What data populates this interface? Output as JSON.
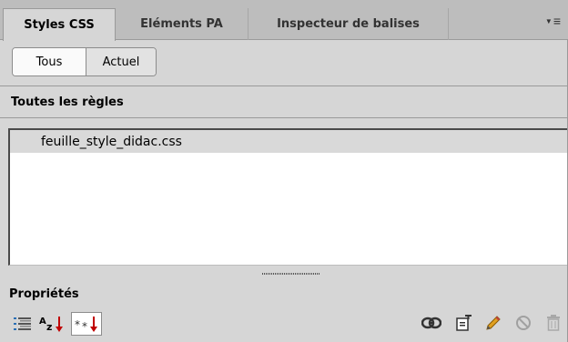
{
  "tabs": [
    {
      "label": "Styles CSS",
      "active": true
    },
    {
      "label": "Eléments PA",
      "active": false
    },
    {
      "label": "Inspecteur de balises",
      "active": false
    }
  ],
  "view_toggle": {
    "all": "Tous",
    "current": "Actuel",
    "selected": "all"
  },
  "rules_section": {
    "title": "Toutes les règles",
    "items": [
      {
        "label": "feuille_style_didac.css",
        "selected": true
      }
    ]
  },
  "properties_section": {
    "title": "Propriétés",
    "view_icons": [
      "category-view-icon",
      "alphabetical-view-icon",
      "set-properties-view-icon"
    ],
    "action_icons": [
      "attach-stylesheet-icon",
      "new-css-rule-icon",
      "edit-style-icon",
      "disable-property-icon",
      "delete-rule-icon"
    ],
    "sort_glyph_az": "Az",
    "sort_glyph_set": "**"
  },
  "colors": {
    "panel_bg": "#d6d6d6",
    "tabbar_bg": "#bdbdbd",
    "selected_row": "#d9d9d9",
    "sort_arrow": "#c00000",
    "pencil": "#e0a020"
  }
}
